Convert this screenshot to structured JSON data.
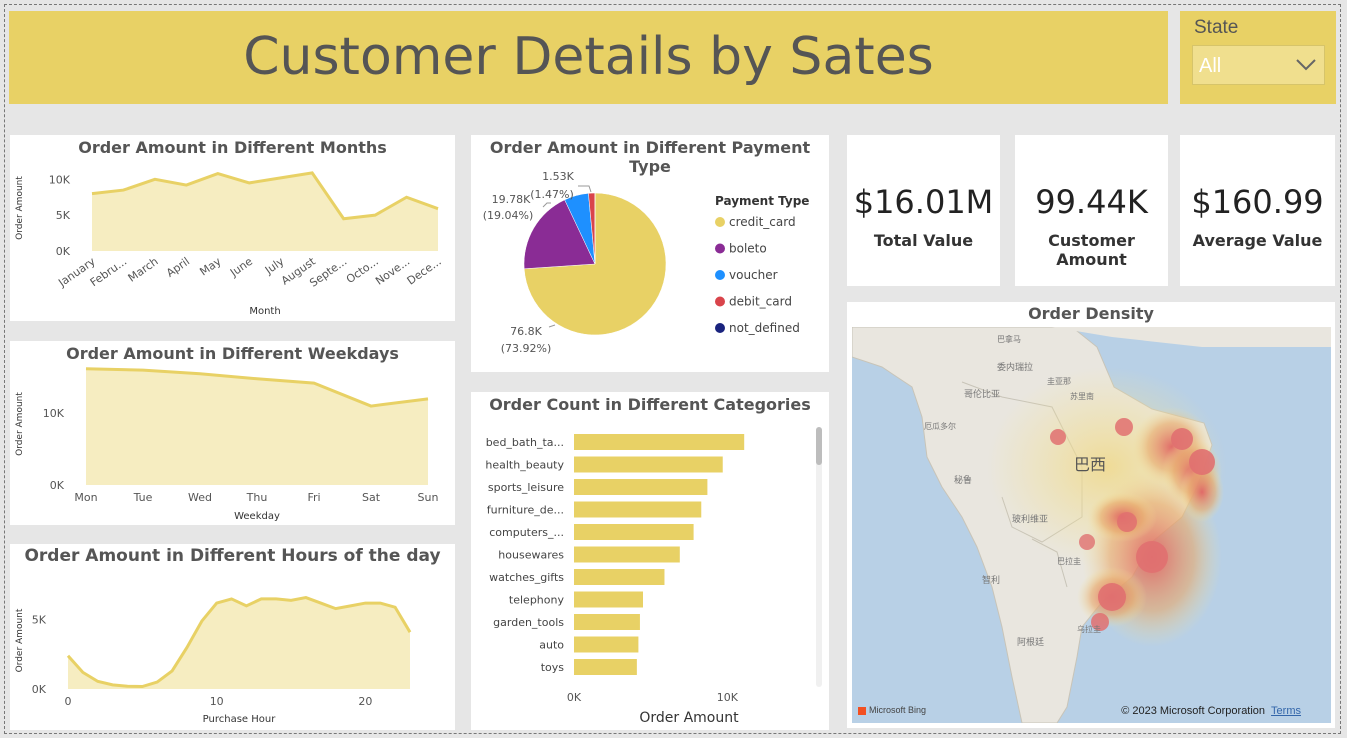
{
  "header": {
    "title": "Customer Details by Sates"
  },
  "slicer": {
    "label": "State",
    "value": "All"
  },
  "kpis": [
    {
      "value": "$16.01M",
      "label": "Total Value"
    },
    {
      "value": "99.44K",
      "label": "Customer Amount"
    },
    {
      "value": "$160.99",
      "label": "Average Value"
    }
  ],
  "map": {
    "title": "Order Density",
    "copyright": "© 2023 Microsoft Corporation",
    "terms": "Terms",
    "bing": "Microsoft Bing",
    "labels": {
      "brazil": "巴西",
      "peru": "秘鲁",
      "bolivia": "玻利维亚",
      "chile": "智利",
      "argentina": "阿根廷",
      "paraguay": "巴拉圭",
      "uruguay": "乌拉圭",
      "venezuela": "委内瑞拉",
      "colombia": "哥伦比亚",
      "ecuador": "厄瓜多尔",
      "suriname": "苏里南",
      "guyana": "圭亚那",
      "panama": "巴拿马"
    }
  },
  "chart_data": [
    {
      "id": "months",
      "type": "area",
      "title": "Order Amount in Different Months",
      "xlabel": "Month",
      "ylabel": "Order Amount",
      "categories": [
        "January",
        "Febru...",
        "March",
        "April",
        "May",
        "June",
        "July",
        "August",
        "Septe...",
        "Octo...",
        "Nove...",
        "Dece..."
      ],
      "values": [
        8000,
        8500,
        10000,
        9200,
        10800,
        9500,
        10200,
        10900,
        4500,
        5000,
        7500,
        5900
      ],
      "yticks": [
        "0K",
        "5K",
        "10K"
      ],
      "ylim": [
        0,
        12000
      ],
      "color": "#e8d165"
    },
    {
      "id": "weekdays",
      "type": "area",
      "title": "Order Amount in Different Weekdays",
      "xlabel": "Weekday",
      "ylabel": "Order Amount",
      "categories": [
        "Mon",
        "Tue",
        "Wed",
        "Thu",
        "Fri",
        "Sat",
        "Sun"
      ],
      "values": [
        16200,
        16000,
        15500,
        14800,
        14200,
        11000,
        12000
      ],
      "yticks": [
        "0K",
        "10K"
      ],
      "ylim": [
        0,
        17000
      ],
      "color": "#e8d165"
    },
    {
      "id": "hours",
      "type": "area",
      "title": "Order Amount in Different Hours of the day",
      "xlabel": "Purchase Hour",
      "ylabel": "Order Amount",
      "x": [
        0,
        1,
        2,
        3,
        4,
        5,
        6,
        7,
        8,
        9,
        10,
        11,
        12,
        13,
        14,
        15,
        16,
        17,
        18,
        19,
        20,
        21,
        22,
        23
      ],
      "values": [
        2400,
        1200,
        550,
        300,
        200,
        180,
        500,
        1300,
        3000,
        4900,
        6200,
        6500,
        6000,
        6500,
        6500,
        6400,
        6600,
        6200,
        5800,
        6000,
        6200,
        6200,
        5900,
        4100
      ],
      "xticks": [
        0,
        10,
        20
      ],
      "yticks": [
        "0K",
        "5K"
      ],
      "ylim": [
        0,
        7000
      ],
      "color": "#e8d165"
    },
    {
      "id": "payment",
      "type": "pie",
      "title": "Order Amount in Different Payment Type",
      "legend_title": "Payment Type",
      "slices": [
        {
          "name": "credit_card",
          "value": 76.8,
          "label": "76.8K",
          "pct": "(73.92%)",
          "color": "#e8d165"
        },
        {
          "name": "boleto",
          "value": 19.78,
          "label": "19.78K",
          "pct": "(19.04%)",
          "color": "#8a2c95"
        },
        {
          "name": "voucher",
          "value": 5.77,
          "label": "",
          "pct": "",
          "color": "#1e90ff"
        },
        {
          "name": "debit_card",
          "value": 1.53,
          "label": "1.53K",
          "pct": "(1.47%)",
          "color": "#d9444b"
        },
        {
          "name": "not_defined",
          "value": 0.003,
          "label": "",
          "pct": "",
          "color": "#1a237e"
        }
      ]
    },
    {
      "id": "categories",
      "type": "bar",
      "title": "Order Count in Different Categories",
      "xlabel": "Order Amount",
      "categories": [
        "bed_bath_ta...",
        "health_beauty",
        "sports_leisure",
        "furniture_de...",
        "computers_...",
        "housewares",
        "watches_gifts",
        "telephony",
        "garden_tools",
        "auto",
        "toys"
      ],
      "values": [
        11100,
        9700,
        8700,
        8300,
        7800,
        6900,
        5900,
        4500,
        4300,
        4200,
        4100
      ],
      "xticks": [
        "0K",
        "10K"
      ],
      "xlim": [
        0,
        15000
      ],
      "color": "#e8d165"
    }
  ]
}
